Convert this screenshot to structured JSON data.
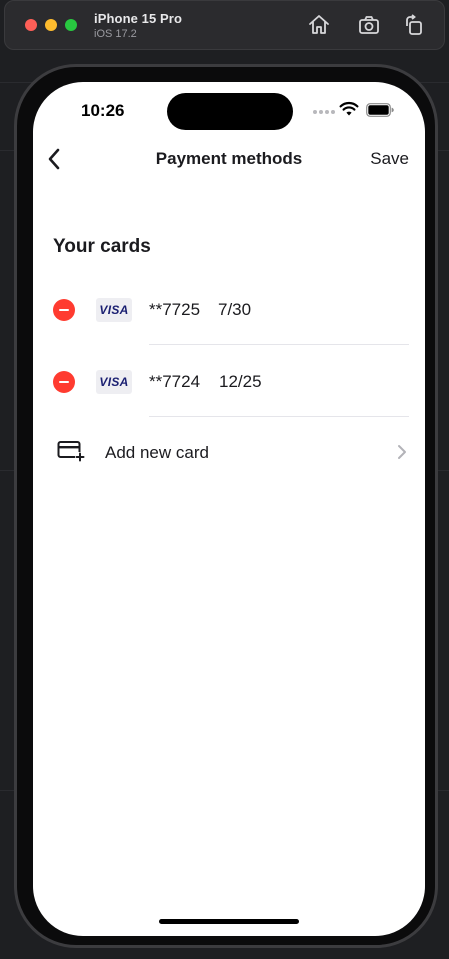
{
  "simulator": {
    "device_name": "iPhone 15 Pro",
    "os_version": "iOS 17.2",
    "controls": [
      "home-icon",
      "screenshot-icon",
      "rotate-icon"
    ]
  },
  "status_bar": {
    "time": "10:26"
  },
  "nav": {
    "title": "Payment methods",
    "save_label": "Save"
  },
  "section": {
    "title": "Your cards"
  },
  "cards": [
    {
      "brand": "VISA",
      "number": "**7725",
      "expiry": "7/30"
    },
    {
      "brand": "VISA",
      "number": "**7724",
      "expiry": "12/25"
    }
  ],
  "add_card": {
    "label": "Add new card"
  },
  "colors": {
    "remove_red": "#ff3b30",
    "visa_navy": "#1a1f71",
    "text_primary": "#1b1b1f",
    "divider": "#e5e5ea"
  }
}
